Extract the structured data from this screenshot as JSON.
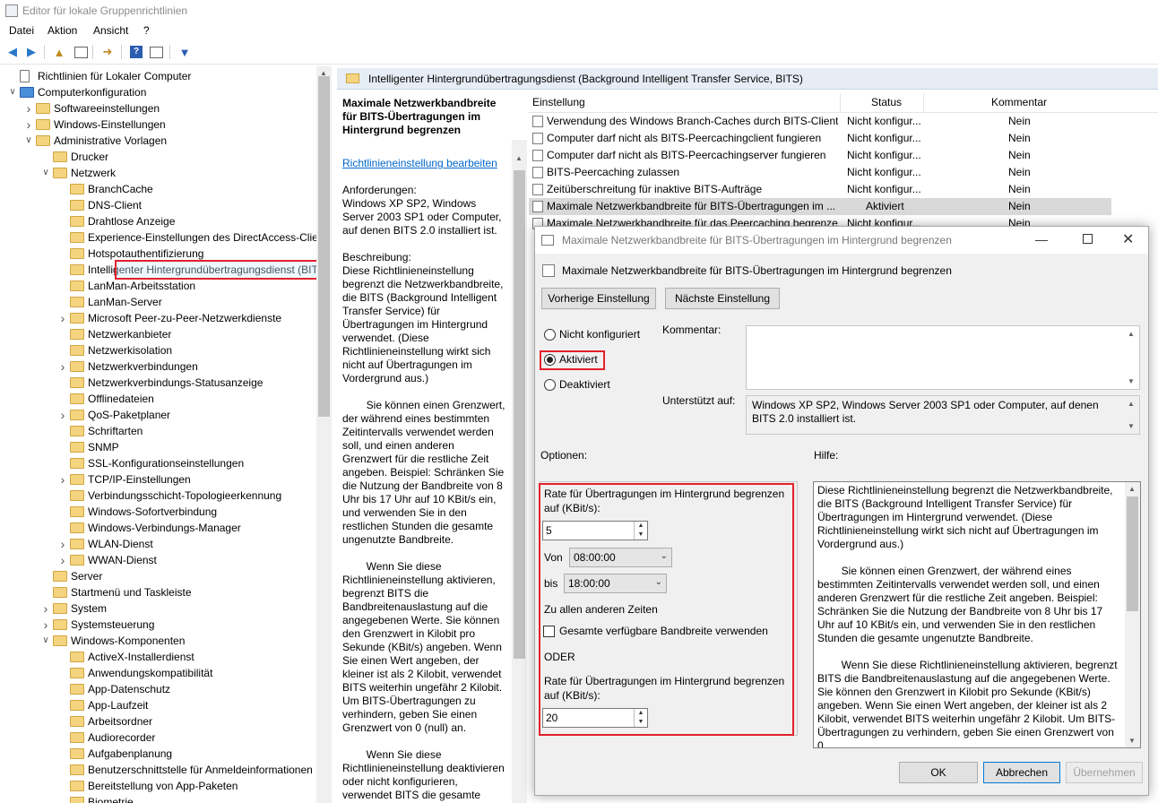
{
  "window": {
    "title": "Editor für lokale Gruppenrichtlinien"
  },
  "menu": [
    "Datei",
    "Aktion",
    "Ansicht",
    "?"
  ],
  "tree": [
    {
      "label": "Richtlinien für Lokaler Computer",
      "indent": 0,
      "exp": "",
      "icon": "doc"
    },
    {
      "label": "Computerkonfiguration",
      "indent": 1,
      "exp": "v",
      "icon": "pc"
    },
    {
      "label": "Softwareeinstellungen",
      "indent": 2,
      "exp": ">",
      "icon": "folder"
    },
    {
      "label": "Windows-Einstellungen",
      "indent": 2,
      "exp": ">",
      "icon": "folder"
    },
    {
      "label": "Administrative Vorlagen",
      "indent": 2,
      "exp": "v",
      "icon": "folder"
    },
    {
      "label": "Drucker",
      "indent": 3,
      "exp": "",
      "icon": "folder"
    },
    {
      "label": "Netzwerk",
      "indent": 3,
      "exp": "v",
      "icon": "folder"
    },
    {
      "label": "BranchCache",
      "indent": 4,
      "exp": "",
      "icon": "folder"
    },
    {
      "label": "DNS-Client",
      "indent": 4,
      "exp": "",
      "icon": "folder"
    },
    {
      "label": "Drahtlose Anzeige",
      "indent": 4,
      "exp": "",
      "icon": "folder"
    },
    {
      "label": "Experience-Einstellungen des DirectAccess-Clients",
      "indent": 4,
      "exp": "",
      "icon": "folder"
    },
    {
      "label": "Hotspotauthentifizierung",
      "indent": 4,
      "exp": "",
      "icon": "folder"
    },
    {
      "label": "Intelligenter Hintergrundübertragungsdienst (BITS)",
      "indent": 4,
      "exp": "",
      "icon": "folder",
      "selected": true
    },
    {
      "label": "LanMan-Arbeitsstation",
      "indent": 4,
      "exp": "",
      "icon": "folder"
    },
    {
      "label": "LanMan-Server",
      "indent": 4,
      "exp": "",
      "icon": "folder"
    },
    {
      "label": "Microsoft Peer-zu-Peer-Netzwerkdienste",
      "indent": 4,
      "exp": ">",
      "icon": "folder"
    },
    {
      "label": "Netzwerkanbieter",
      "indent": 4,
      "exp": "",
      "icon": "folder"
    },
    {
      "label": "Netzwerkisolation",
      "indent": 4,
      "exp": "",
      "icon": "folder"
    },
    {
      "label": "Netzwerkverbindungen",
      "indent": 4,
      "exp": ">",
      "icon": "folder"
    },
    {
      "label": "Netzwerkverbindungs-Statusanzeige",
      "indent": 4,
      "exp": "",
      "icon": "folder"
    },
    {
      "label": "Offlinedateien",
      "indent": 4,
      "exp": "",
      "icon": "folder"
    },
    {
      "label": "QoS-Paketplaner",
      "indent": 4,
      "exp": ">",
      "icon": "folder"
    },
    {
      "label": "Schriftarten",
      "indent": 4,
      "exp": "",
      "icon": "folder"
    },
    {
      "label": "SNMP",
      "indent": 4,
      "exp": "",
      "icon": "folder"
    },
    {
      "label": "SSL-Konfigurationseinstellungen",
      "indent": 4,
      "exp": "",
      "icon": "folder"
    },
    {
      "label": "TCP/IP-Einstellungen",
      "indent": 4,
      "exp": ">",
      "icon": "folder"
    },
    {
      "label": "Verbindungsschicht-Topologieerkennung",
      "indent": 4,
      "exp": "",
      "icon": "folder"
    },
    {
      "label": "Windows-Sofortverbindung",
      "indent": 4,
      "exp": "",
      "icon": "folder"
    },
    {
      "label": "Windows-Verbindungs-Manager",
      "indent": 4,
      "exp": "",
      "icon": "folder"
    },
    {
      "label": "WLAN-Dienst",
      "indent": 4,
      "exp": ">",
      "icon": "folder"
    },
    {
      "label": "WWAN-Dienst",
      "indent": 4,
      "exp": ">",
      "icon": "folder"
    },
    {
      "label": "Server",
      "indent": 3,
      "exp": "",
      "icon": "folder"
    },
    {
      "label": "Startmenü und Taskleiste",
      "indent": 3,
      "exp": "",
      "icon": "folder"
    },
    {
      "label": "System",
      "indent": 3,
      "exp": ">",
      "icon": "folder"
    },
    {
      "label": "Systemsteuerung",
      "indent": 3,
      "exp": ">",
      "icon": "folder"
    },
    {
      "label": "Windows-Komponenten",
      "indent": 3,
      "exp": "v",
      "icon": "folder"
    },
    {
      "label": "ActiveX-Installerdienst",
      "indent": 4,
      "exp": "",
      "icon": "folder"
    },
    {
      "label": "Anwendungskompatibilität",
      "indent": 4,
      "exp": "",
      "icon": "folder"
    },
    {
      "label": "App-Datenschutz",
      "indent": 4,
      "exp": "",
      "icon": "folder"
    },
    {
      "label": "App-Laufzeit",
      "indent": 4,
      "exp": "",
      "icon": "folder"
    },
    {
      "label": "Arbeitsordner",
      "indent": 4,
      "exp": "",
      "icon": "folder"
    },
    {
      "label": "Audiorecorder",
      "indent": 4,
      "exp": "",
      "icon": "folder"
    },
    {
      "label": "Aufgabenplanung",
      "indent": 4,
      "exp": "",
      "icon": "folder"
    },
    {
      "label": "Benutzerschnittstelle für Anmeldeinformationen",
      "indent": 4,
      "exp": "",
      "icon": "folder"
    },
    {
      "label": "Bereitstellung von App-Paketen",
      "indent": 4,
      "exp": "",
      "icon": "folder"
    },
    {
      "label": "Biometrie",
      "indent": 4,
      "exp": "",
      "icon": "folder"
    }
  ],
  "right": {
    "header": "Intelligenter Hintergrundübertragungsdienst (Background Intelligent Transfer Service, BITS)",
    "desc_title": "Maximale Netzwerkbandbreite für BITS-Übertragungen im Hintergrund begrenzen",
    "desc_link": "Richtlinieneinstellung bearbeiten",
    "desc_paragraphs": [
      "Anforderungen:\nWindows XP SP2, Windows Server 2003 SP1 oder Computer, auf denen BITS 2.0 installiert ist.",
      "Beschreibung:\nDiese Richtlinieneinstellung begrenzt die Netzwerkbandbreite, die BITS (Background Intelligent Transfer Service) für Übertragungen im Hintergrund verwendet. (Diese Richtlinieneinstellung wirkt sich nicht auf Übertragungen im Vordergrund aus.)",
      "        Sie können einen Grenzwert, der während eines bestimmten Zeitintervalls verwendet werden soll, und einen anderen Grenzwert für die restliche Zeit angeben. Beispiel: Schränken Sie die Nutzung der Bandbreite von 8 Uhr bis 17 Uhr auf 10 KBit/s ein, und verwenden Sie in den restlichen Stunden die gesamte ungenutzte Bandbreite.",
      "        Wenn Sie diese Richtlinieneinstellung aktivieren, begrenzt BITS die Bandbreitenauslastung auf die angegebenen Werte. Sie können den Grenzwert in Kilobit pro Sekunde (KBit/s) angeben. Wenn Sie einen Wert angeben, der kleiner ist als 2 Kilobit, verwendet BITS weiterhin ungefähr 2 Kilobit. Um BITS-Übertragungen zu verhindern, geben Sie einen Grenzwert von 0 (null) an.",
      "        Wenn Sie diese Richtlinieneinstellung deaktivieren oder nicht konfigurieren, verwendet BITS die gesamte verfügbare Bandbreite."
    ],
    "columns": {
      "setting": "Einstellung",
      "status": "Status",
      "comment": "Kommentar"
    },
    "rows": [
      {
        "name": "Verwendung des Windows Branch-Caches durch BITS-Client...",
        "status": "Nicht konfigur...",
        "comment": "Nein"
      },
      {
        "name": "Computer darf nicht als BITS-Peercachingclient fungieren",
        "status": "Nicht konfigur...",
        "comment": "Nein"
      },
      {
        "name": "Computer darf nicht als BITS-Peercachingserver fungieren",
        "status": "Nicht konfigur...",
        "comment": "Nein"
      },
      {
        "name": "BITS-Peercaching zulassen",
        "status": "Nicht konfigur...",
        "comment": "Nein"
      },
      {
        "name": "Zeitüberschreitung für inaktive BITS-Aufträge",
        "status": "Nicht konfigur...",
        "comment": "Nein"
      },
      {
        "name": "Maximale Netzwerkbandbreite für BITS-Übertragungen im ...",
        "status": "Aktiviert",
        "comment": "Nein",
        "selected": true
      },
      {
        "name": "Maximale Netzwerkbandbreite für das Peercaching begrenzen",
        "status": "Nicht konfigur...",
        "comment": "Nein"
      }
    ]
  },
  "dialog": {
    "title": "Maximale Netzwerkbandbreite für BITS-Übertragungen im Hintergrund begrenzen",
    "heading": "Maximale Netzwerkbandbreite für BITS-Übertragungen im Hintergrund begrenzen",
    "prev_btn": "Vorherige Einstellung",
    "next_btn": "Nächste Einstellung",
    "radio_not_configured": "Nicht konfiguriert",
    "radio_enabled": "Aktiviert",
    "radio_disabled": "Deaktiviert",
    "selected_state": "Aktiviert",
    "comment_label": "Kommentar:",
    "supported_label": "Unterstützt auf:",
    "supported_text": "Windows XP SP2, Windows Server 2003 SP1 oder Computer, auf denen BITS 2.0 installiert ist.",
    "options_label": "Optionen:",
    "help_label": "Hilfe:",
    "opt_rate_label": "Rate für Übertragungen im Hintergrund begrenzen auf (KBit/s):",
    "opt_rate_value": "5",
    "opt_from_label": "Von",
    "opt_from_value": "08:00:00",
    "opt_to_label": "bis",
    "opt_to_value": "18:00:00",
    "opt_other_times": "Zu allen anderen Zeiten",
    "opt_use_all": "Gesamte verfügbare Bandbreite verwenden",
    "opt_use_all_checked": false,
    "opt_or": "ODER",
    "opt_rate2_label": "Rate für Übertragungen im Hintergrund begrenzen auf (KBit/s):",
    "opt_rate2_value": "20",
    "help_paragraphs": [
      "Diese Richtlinieneinstellung begrenzt die Netzwerkbandbreite, die BITS (Background Intelligent Transfer Service) für Übertragungen im Hintergrund verwendet. (Diese Richtlinieneinstellung wirkt sich nicht auf Übertragungen im Vordergrund aus.)",
      "        Sie können einen Grenzwert, der während eines bestimmten Zeitintervalls verwendet werden soll, und einen anderen Grenzwert für die restliche Zeit angeben. Beispiel: Schränken Sie die Nutzung der Bandbreite von 8 Uhr bis 17 Uhr auf 10 KBit/s ein, und verwenden Sie in den restlichen Stunden die gesamte ungenutzte Bandbreite.",
      "        Wenn Sie diese Richtlinieneinstellung aktivieren, begrenzt BITS die Bandbreitenauslastung auf die angegebenen Werte. Sie können den Grenzwert in Kilobit pro Sekunde (KBit/s) angeben. Wenn Sie einen Wert angeben, der kleiner ist als 2 Kilobit, verwendet BITS weiterhin ungefähr 2 Kilobit. Um BITS-Übertragungen zu verhindern, geben Sie einen Grenzwert von 0"
    ],
    "ok": "OK",
    "cancel": "Abbrechen",
    "apply": "Übernehmen"
  },
  "colors": {
    "highlight": "#e1212b",
    "selection": "#cce8ff",
    "link": "#0066cc",
    "header_bg": "#e7edf5"
  }
}
